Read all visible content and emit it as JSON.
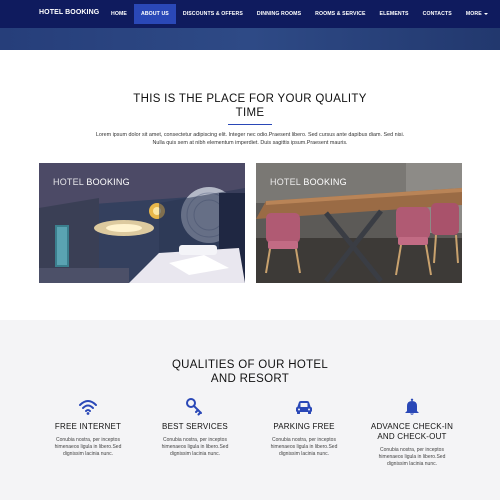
{
  "navbar": {
    "brand": "HOTEL BOOKING",
    "items": [
      {
        "label": "HOME",
        "active": false
      },
      {
        "label": "ABOUT US",
        "active": true
      },
      {
        "label": "DISCOUNTS & OFFERS",
        "active": false
      },
      {
        "label": "DINNING ROOMS",
        "active": false
      },
      {
        "label": "ROOMS & SERVICE",
        "active": false
      },
      {
        "label": "ELEMENTS",
        "active": false
      },
      {
        "label": "CONTACTS",
        "active": false
      },
      {
        "label": "MORE",
        "active": false
      }
    ]
  },
  "intro": {
    "title_line1": "THIS IS THE PLACE FOR YOUR QUALITY",
    "title_line2": "TIME",
    "paragraph_line1": "Lorem ipsum dolor sit amet, consectetur adipiscing elit. Integer nec odio.Praesent libero. Sed cursus ante dapibus diam. Sed nisi.",
    "paragraph_line2": "Nulla quis sem at nibh elementum imperdiet. Duis sagittis ipsum.Praesent mauris."
  },
  "cards": [
    {
      "label_a": "HOTEL",
      "label_b": "BOOKING"
    },
    {
      "label_a": "HOTEL",
      "label_b": "BOOKING"
    }
  ],
  "qualities": {
    "title_line1": "QUALITIES OF OUR HOTEL",
    "title_line2": "AND RESORT",
    "accent_color": "#2a48b7",
    "features": [
      {
        "icon": "wifi-icon",
        "title_line1": "FREE INTERNET",
        "title_line2": "",
        "desc_line1": "Conubia nostra, per inceptos",
        "desc_line2": "himenaeos ligula in libero.Sed",
        "desc_line3": "dignissim lacinia nunc."
      },
      {
        "icon": "key-icon",
        "title_line1": "BEST SERVICES",
        "title_line2": "",
        "desc_line1": "Conubia nostra, per inceptos",
        "desc_line2": "himenaeos ligula in libero.Sed",
        "desc_line3": "dignissim lacinia nunc."
      },
      {
        "icon": "car-icon",
        "title_line1": "PARKING FREE",
        "title_line2": "",
        "desc_line1": "Conubia nostra, per inceptos",
        "desc_line2": "himenaeos ligula in libero.Sed",
        "desc_line3": "dignissim lacinia nunc."
      },
      {
        "icon": "bell-icon",
        "title_line1": "ADVANCE CHECK-IN",
        "title_line2": "AND CHECK-OUT",
        "desc_line1": "Conubia nostra, per inceptos",
        "desc_line2": "himenaeos ligula in libero.Sed",
        "desc_line3": "dignissim lacinia nunc."
      }
    ]
  }
}
